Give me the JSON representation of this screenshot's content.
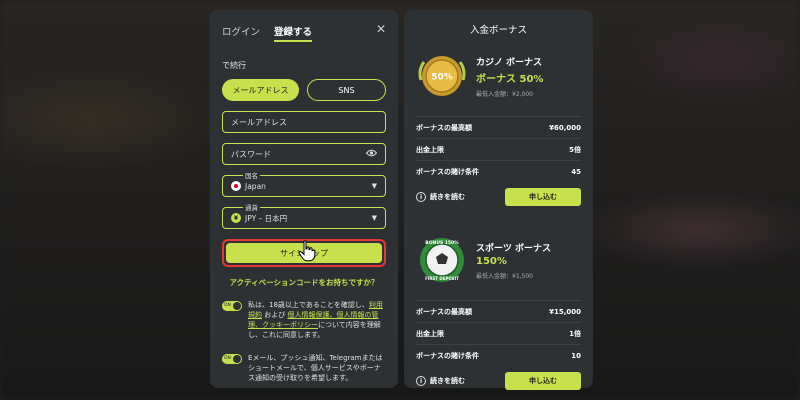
{
  "left_panel": {
    "tabs": [
      {
        "label": "ログイン"
      },
      {
        "label": "登録する"
      }
    ],
    "close_icon": "close-icon",
    "continue_label": "で続行",
    "methods": [
      {
        "label": "メールアドレス"
      },
      {
        "label": "SNS"
      }
    ],
    "email_placeholder": "メールアドレス",
    "password_placeholder": "パスワード",
    "country": {
      "label": "国名",
      "value": "Japan"
    },
    "currency": {
      "label": "通貨",
      "value": "JPY – 日本円"
    },
    "signup_label": "サインアップ",
    "promo_link": "アクティベーションコードをお持ちですか？",
    "consent1": {
      "toggle": "ON",
      "part1": "私は、18歳以上であることを確認し、",
      "link1": "利用規約",
      "part2": " および ",
      "link2": "個人情報保護、個人情報の管理、クッキーポリシー",
      "part3": "について内容を理解し、これに同意します。"
    },
    "consent2": {
      "toggle": "ON",
      "text": "Eメール、プッシュ通知、Telegramまたはショートメールで、個人サービスやボーナス通知の受け取りを希望します。"
    }
  },
  "right_panel": {
    "title": "入金ボーナス",
    "bonuses": [
      {
        "name": "カジノ ボーナス",
        "percent": "ボーナス 50%",
        "min_deposit": "最低入金額：¥2,000",
        "medal_text": "50%",
        "rows": [
          {
            "label": "ボーナスの最高額",
            "value": "¥60,000"
          },
          {
            "label": "出金上限",
            "value": "5倍"
          },
          {
            "label": "ボーナスの賭け条件",
            "value": "45"
          }
        ],
        "readmore": "続きを読む",
        "apply": "申し込む"
      },
      {
        "name": "スポーツ ボーナス",
        "percent": "150%",
        "min_deposit": "最低入金額：¥1,500",
        "medal_text_top": "BONUS 150%",
        "medal_text_bottom": "FIRST DEPOSIT",
        "rows": [
          {
            "label": "ボーナスの最高額",
            "value": "¥15,000"
          },
          {
            "label": "出金上限",
            "value": "1倍"
          },
          {
            "label": "ボーナスの賭け条件",
            "value": "10"
          }
        ],
        "readmore": "続きを読む",
        "apply": "申し込む"
      }
    ]
  },
  "colors": {
    "accent": "#c7e04b",
    "panel": "#2e3134",
    "highlight": "#e53935"
  }
}
